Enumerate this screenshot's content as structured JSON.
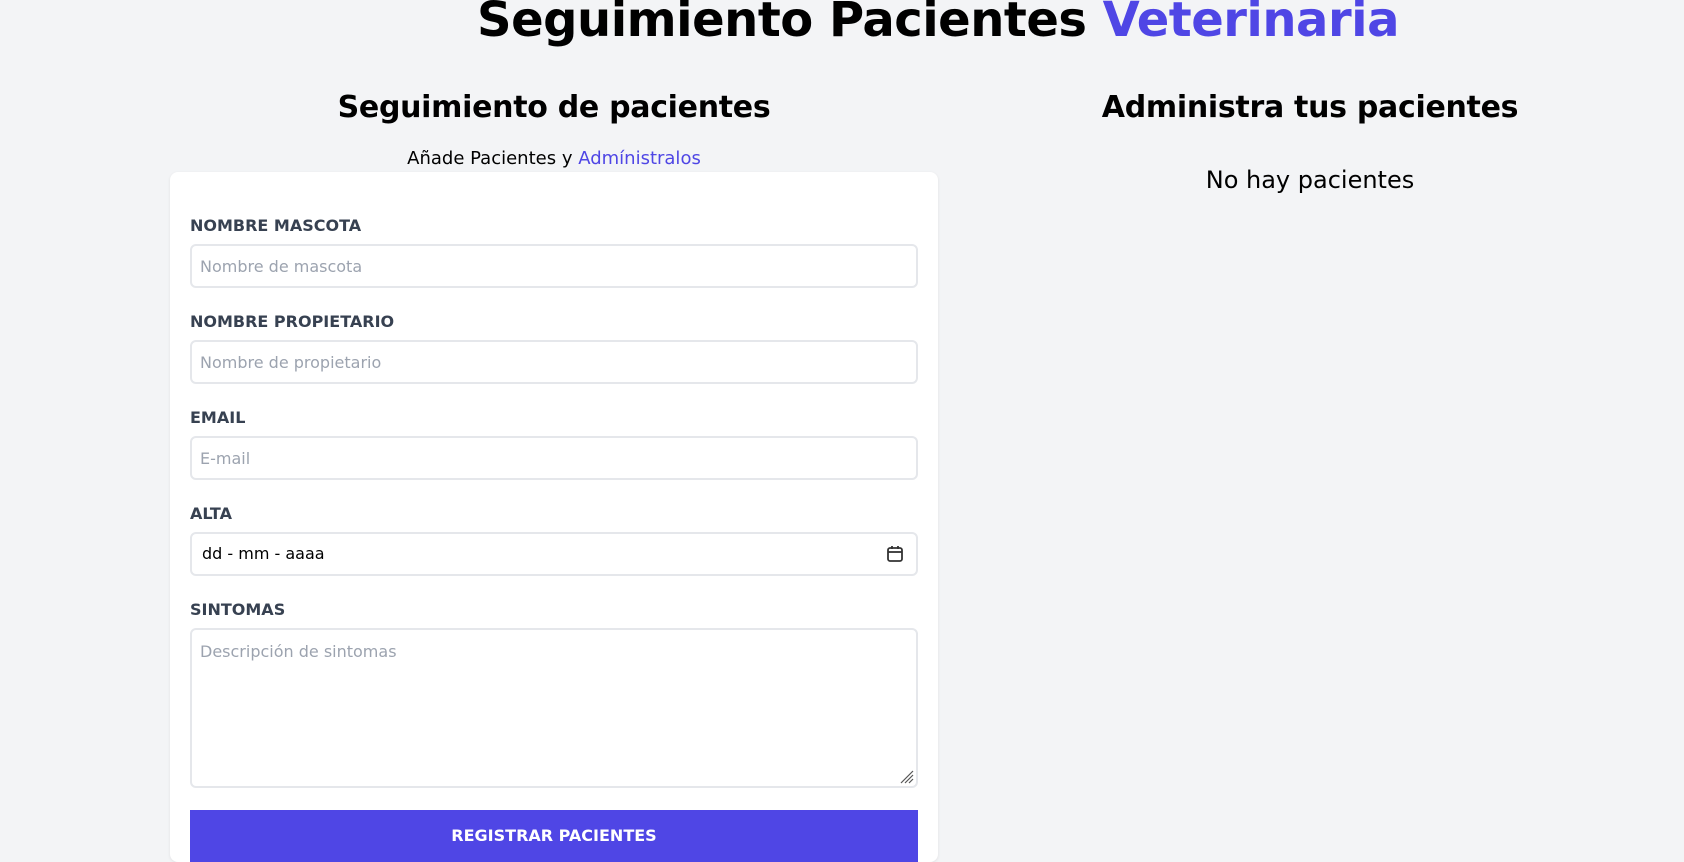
{
  "header": {
    "title_main": "Seguimiento Pacientes ",
    "title_accent": "Veterinaria"
  },
  "form_section": {
    "title": "Seguimiento de pacientes",
    "subtitle_prefix": "Añade Pacientes y ",
    "subtitle_accent": "Admínistralos",
    "fields": {
      "pet_name": {
        "label": "NOMBRE MASCOTA",
        "placeholder": "Nombre de mascota",
        "value": ""
      },
      "owner_name": {
        "label": "NOMBRE PROPIETARIO",
        "placeholder": "Nombre de propietario",
        "value": ""
      },
      "email": {
        "label": "EMAIL",
        "placeholder": "E-mail",
        "value": ""
      },
      "discharge": {
        "label": "ALTA",
        "display": "dd - mm - aaaa"
      },
      "symptoms": {
        "label": "SINTOMAS",
        "placeholder": "Descripción de sintomas",
        "value": ""
      }
    },
    "submit_label": "REGISTRAR PACIENTES"
  },
  "list_section": {
    "title": "Administra tus pacientes",
    "empty_message": "No hay pacientes"
  },
  "colors": {
    "accent": "#4f46e5",
    "background": "#f3f4f6",
    "label": "#374151"
  },
  "icons": {
    "date_picker": "calendar-icon",
    "textarea_resize": "resize-handle-icon"
  }
}
